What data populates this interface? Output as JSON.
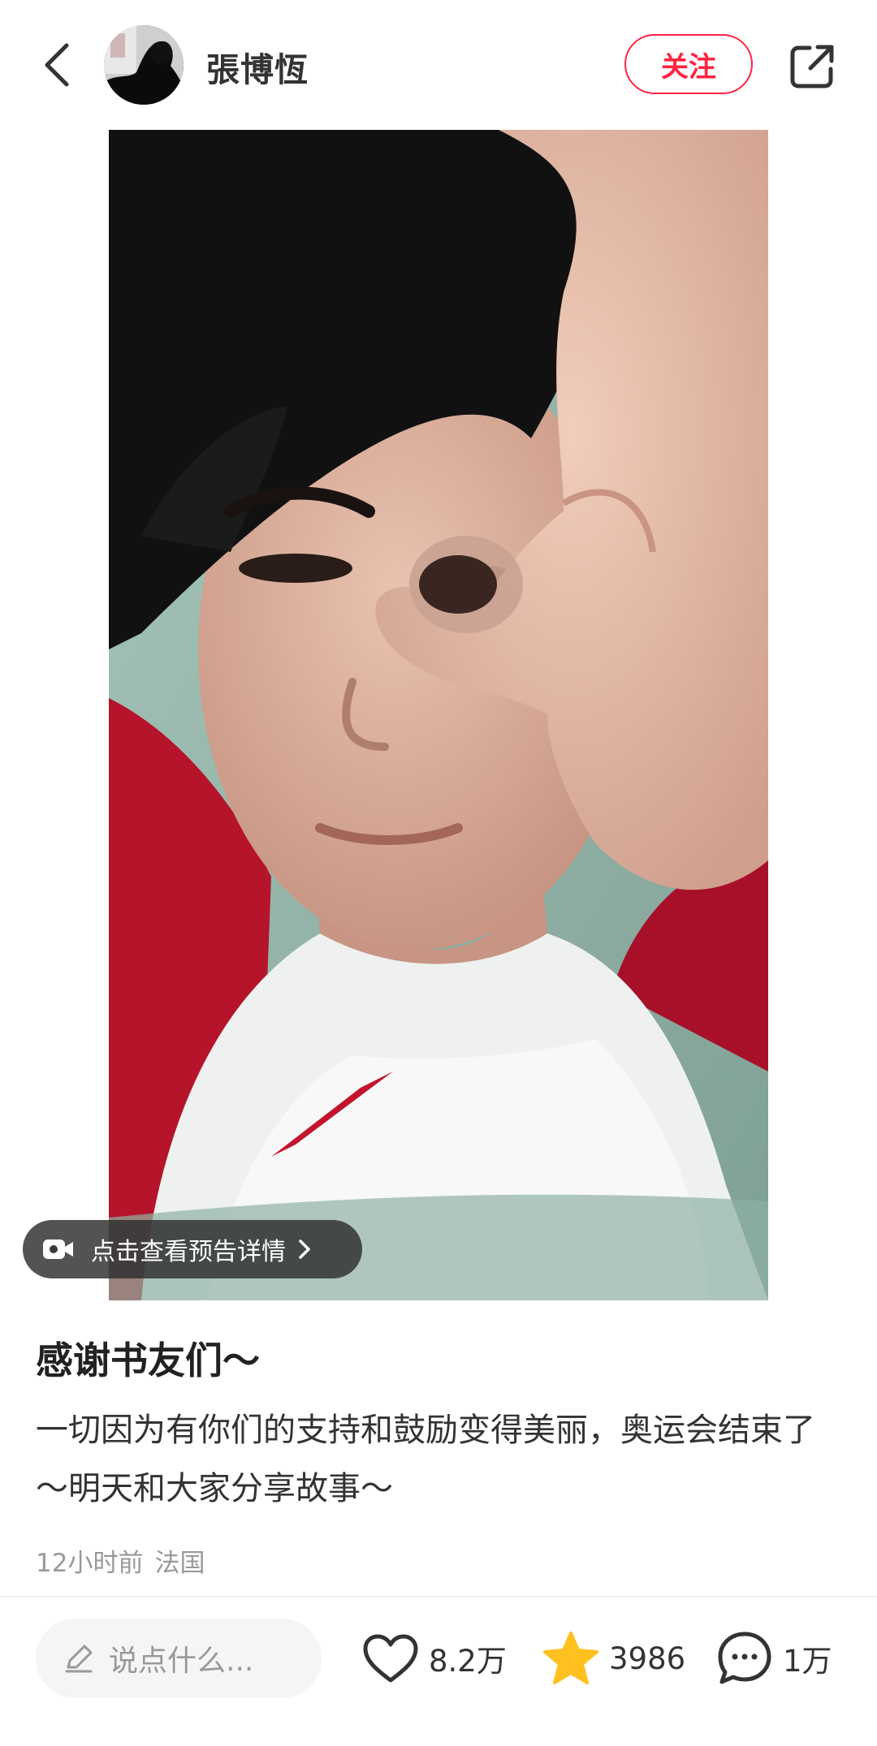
{
  "header": {
    "username": "張博恆",
    "follow_label": "关注"
  },
  "media": {
    "preview_label": "点击查看预告详情"
  },
  "post": {
    "title": "感谢书友们～",
    "body": "一切因为有你们的支持和鼓励变得美丽，奥运会结束了～明天和大家分享故事～",
    "time": "12小时前",
    "location": "法国"
  },
  "bottom_bar": {
    "comment_placeholder": "说点什么...",
    "likes": "8.2万",
    "favorites": "3986",
    "comments": "1万"
  },
  "colors": {
    "accent": "#ff2442",
    "star": "#ffc11f",
    "muted": "#999999"
  },
  "icons": [
    "chevron-left-icon",
    "share-icon",
    "camera-icon",
    "chevron-right-icon",
    "pen-icon",
    "heart-icon",
    "star-icon",
    "comment-bubble-icon"
  ]
}
